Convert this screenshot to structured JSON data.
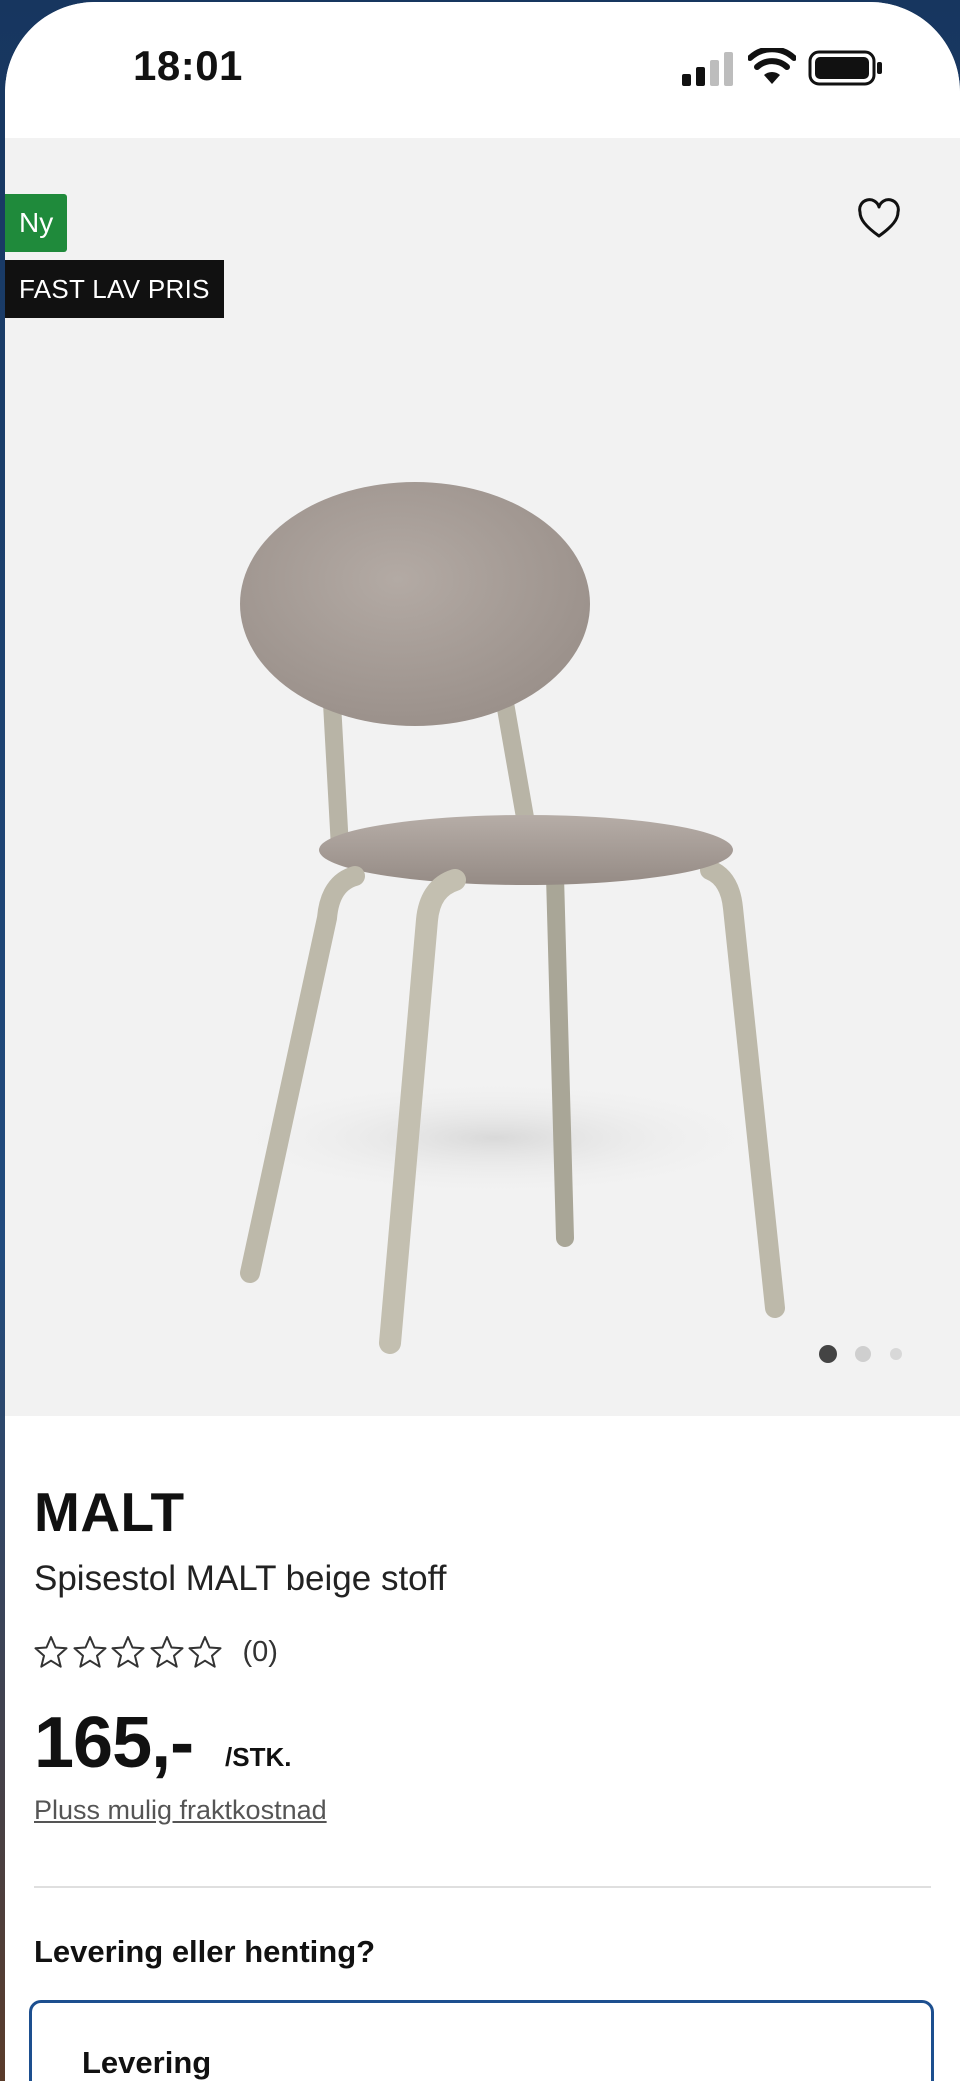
{
  "status_bar": {
    "time": "18:01",
    "signal_icon": "cellular-signal-icon",
    "wifi_icon": "wifi-icon",
    "battery_icon": "battery-icon"
  },
  "product_image": {
    "badges": {
      "new": "Ny",
      "price_tag": "FAST LAV PRIS"
    },
    "favorite_icon": "heart-outline-icon",
    "image_subject": "chair",
    "carousel": {
      "total": 3,
      "active_index": 0
    }
  },
  "product": {
    "brand": "MALT",
    "description": "Spisestol MALT beige stoff",
    "rating": {
      "stars": 0,
      "max_stars": 5,
      "count_label": "(0)"
    },
    "price": "165,-",
    "unit": "/STK.",
    "shipping_note": "Pluss mulig fraktkostnad"
  },
  "delivery": {
    "heading": "Levering eller henting?",
    "option_label": "Levering"
  },
  "colors": {
    "new_badge": "#1f8a3b",
    "price_badge": "#111111",
    "accent_border": "#1d4f8f",
    "image_background": "#f2f2f2"
  }
}
